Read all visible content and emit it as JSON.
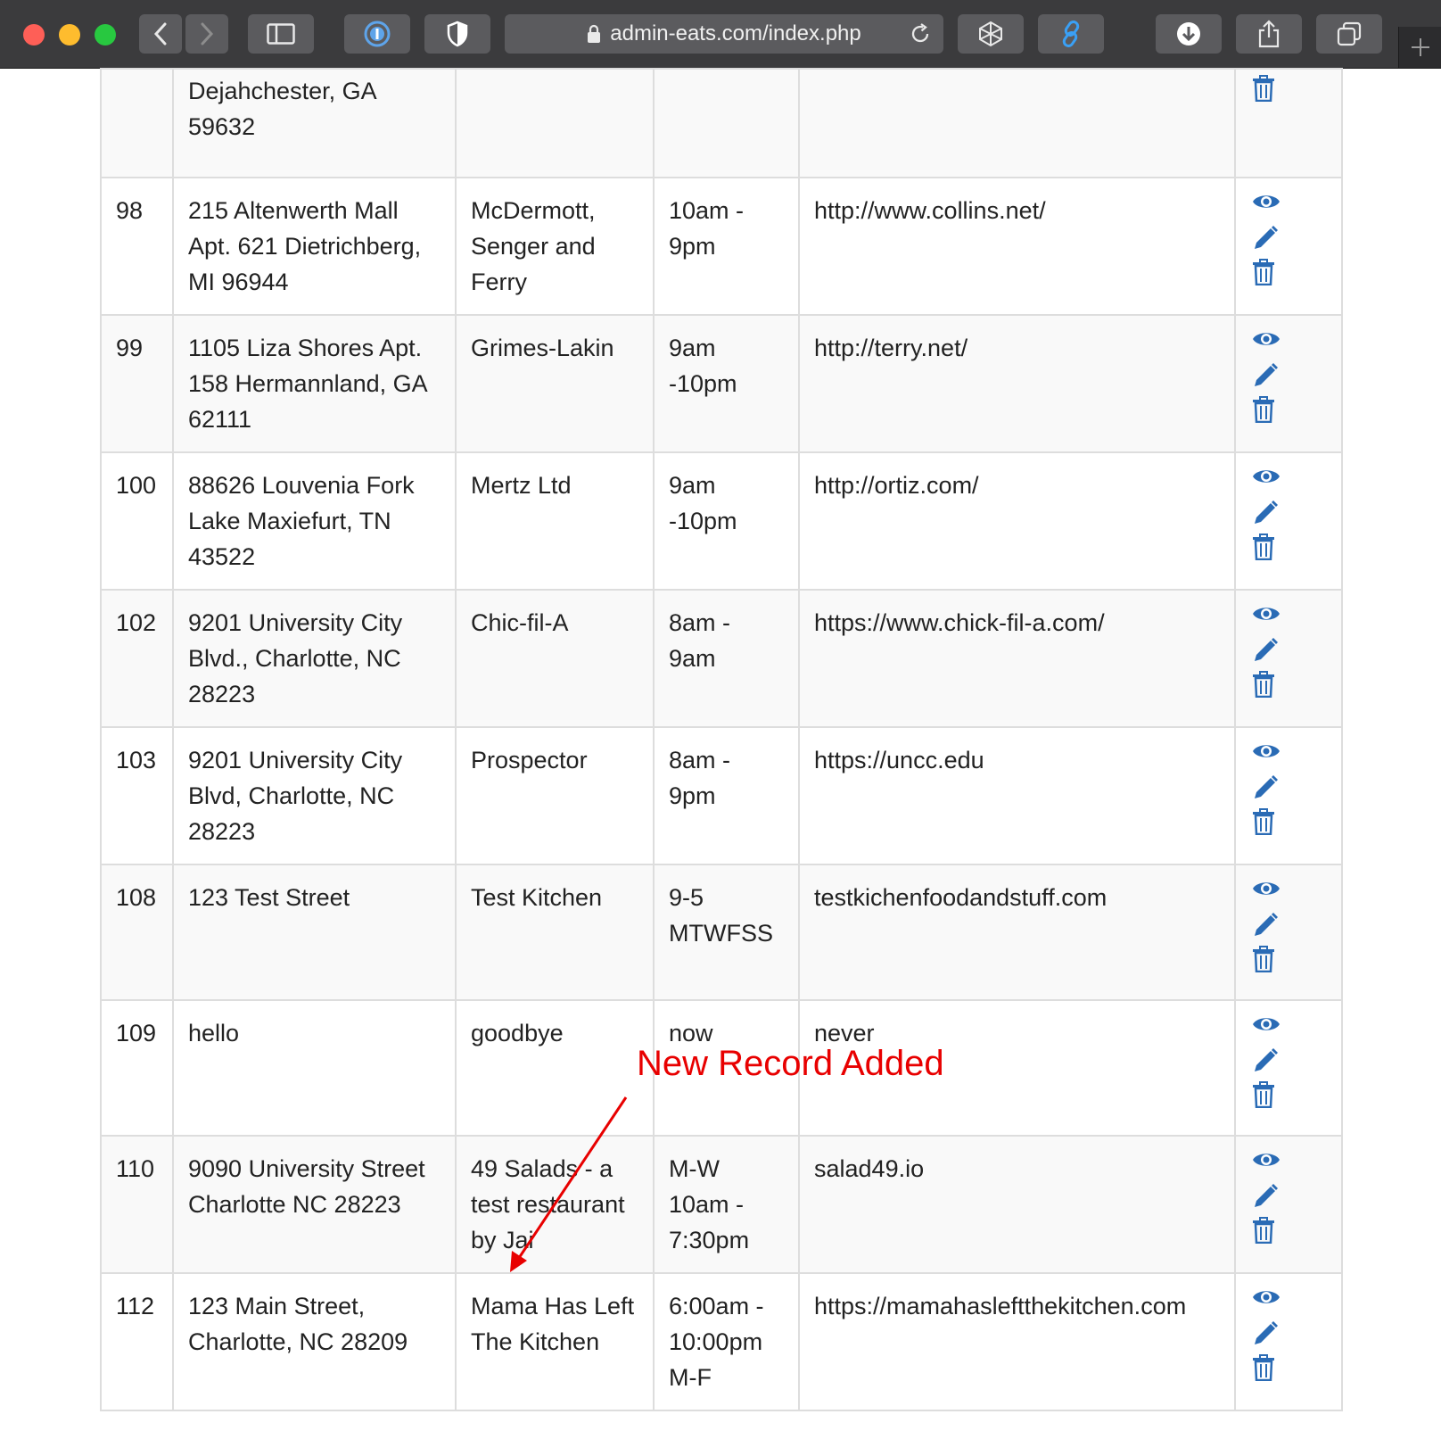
{
  "browser": {
    "url": "admin-eats.com/index.php"
  },
  "rows": [
    {
      "id": "",
      "address": "Dejahchester, GA 59632",
      "name": "",
      "hours": "",
      "website": ""
    },
    {
      "id": "98",
      "address": "215 Altenwerth Mall Apt. 621 Dietrichberg, MI 96944",
      "name": "McDermott, Senger and Ferry",
      "hours": "10am - 9pm",
      "website": "http://www.collins.net/"
    },
    {
      "id": "99",
      "address": "1105 Liza Shores Apt. 158 Hermannland, GA 62111",
      "name": "Grimes-Lakin",
      "hours": "9am -10pm",
      "website": "http://terry.net/"
    },
    {
      "id": "100",
      "address": "88626 Louvenia Fork Lake Maxiefurt, TN 43522",
      "name": "Mertz Ltd",
      "hours": "9am -10pm",
      "website": "http://ortiz.com/"
    },
    {
      "id": "102",
      "address": "9201 University City Blvd., Charlotte, NC 28223",
      "name": "Chic-fil-A",
      "hours": "8am - 9am",
      "website": "https://www.chick-fil-a.com/"
    },
    {
      "id": "103",
      "address": "9201 University City Blvd, Charlotte, NC 28223",
      "name": "Prospector",
      "hours": "8am - 9pm",
      "website": "https://uncc.edu"
    },
    {
      "id": "108",
      "address": "123 Test Street",
      "name": "Test Kitchen",
      "hours": "9-5 MTWFSS",
      "website": "testkichenfoodandstuff.com"
    },
    {
      "id": "109",
      "address": "hello",
      "name": "goodbye",
      "hours": "now",
      "website": "never"
    },
    {
      "id": "110",
      "address": "9090 University Street Charlotte NC 28223",
      "name": "49 Salads - a test restaurant by Jai",
      "hours": "M-W 10am - 7:30pm",
      "website": "salad49.io"
    },
    {
      "id": "112",
      "address": "123 Main Street, Charlotte, NC 28209",
      "name": "Mama Has Left The Kitchen",
      "hours": "6:00am - 10:00pm M-F",
      "website": "https://mamahasleftthekitchen.com"
    }
  ],
  "annotation": {
    "text": "New Record Added",
    "color": "#e80000"
  },
  "colors": {
    "icon": "#2a6bb5",
    "border": "#dddddd",
    "stripe": "#f9f9f9"
  },
  "icons": [
    "view-eye-icon",
    "edit-pencil-icon",
    "delete-trash-icon"
  ]
}
